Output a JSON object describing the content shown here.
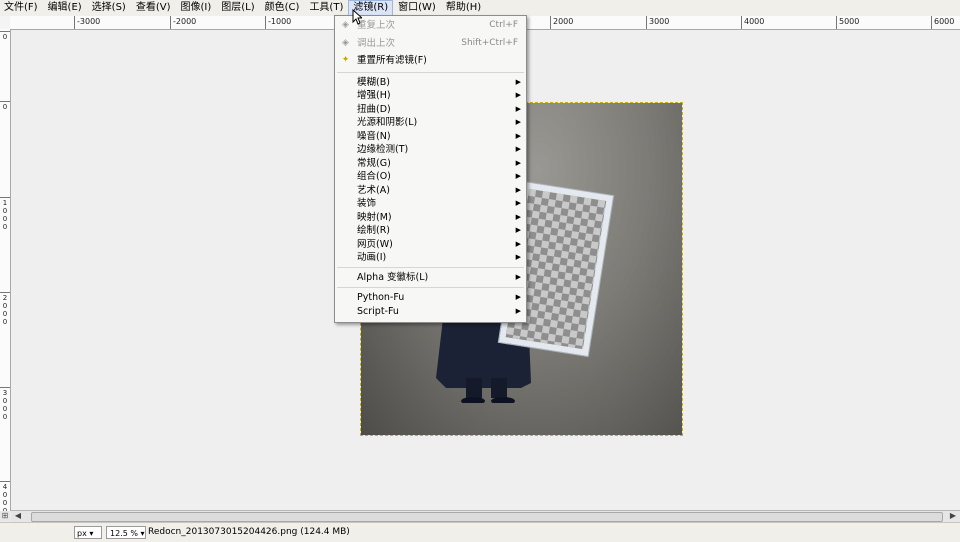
{
  "menubar": {
    "items": [
      "文件(F)",
      "编辑(E)",
      "选择(S)",
      "查看(V)",
      "图像(I)",
      "图层(L)",
      "颜色(C)",
      "工具(T)",
      "滤镜(R)",
      "窗口(W)",
      "帮助(H)"
    ]
  },
  "ruler_top": [
    "-3000",
    "-2000",
    "-1000",
    "2000",
    "3000",
    "4000",
    "5000",
    "6000"
  ],
  "ruler_left": [
    "0",
    "0",
    "1000",
    "2000",
    "3000",
    "4000"
  ],
  "filters_menu": {
    "repeat": {
      "label": "重复上次",
      "accel": "Ctrl+F"
    },
    "reshow": {
      "label": "调出上次",
      "accel": "Shift+Ctrl+F"
    },
    "reset": {
      "label": "重置所有滤镜(F)"
    },
    "submenus": [
      "模糊(B)",
      "增强(H)",
      "扭曲(D)",
      "光源和阴影(L)",
      "噪音(N)",
      "边缘检测(T)",
      "常规(G)",
      "组合(O)",
      "艺术(A)",
      "装饰",
      "映射(M)",
      "绘制(R)",
      "网页(W)",
      "动画(I)"
    ],
    "alpha": "Alpha 变徽标(L)",
    "python": "Python-Fu",
    "script": "Script-Fu"
  },
  "statusbar": {
    "unit": "px",
    "zoom": "12.5 %",
    "file_info": "Redocn_20130730152044​26.png (124.4 MB)"
  },
  "colors": {
    "accent": "#dbe5f7",
    "selection_outline": "#c8b400"
  }
}
